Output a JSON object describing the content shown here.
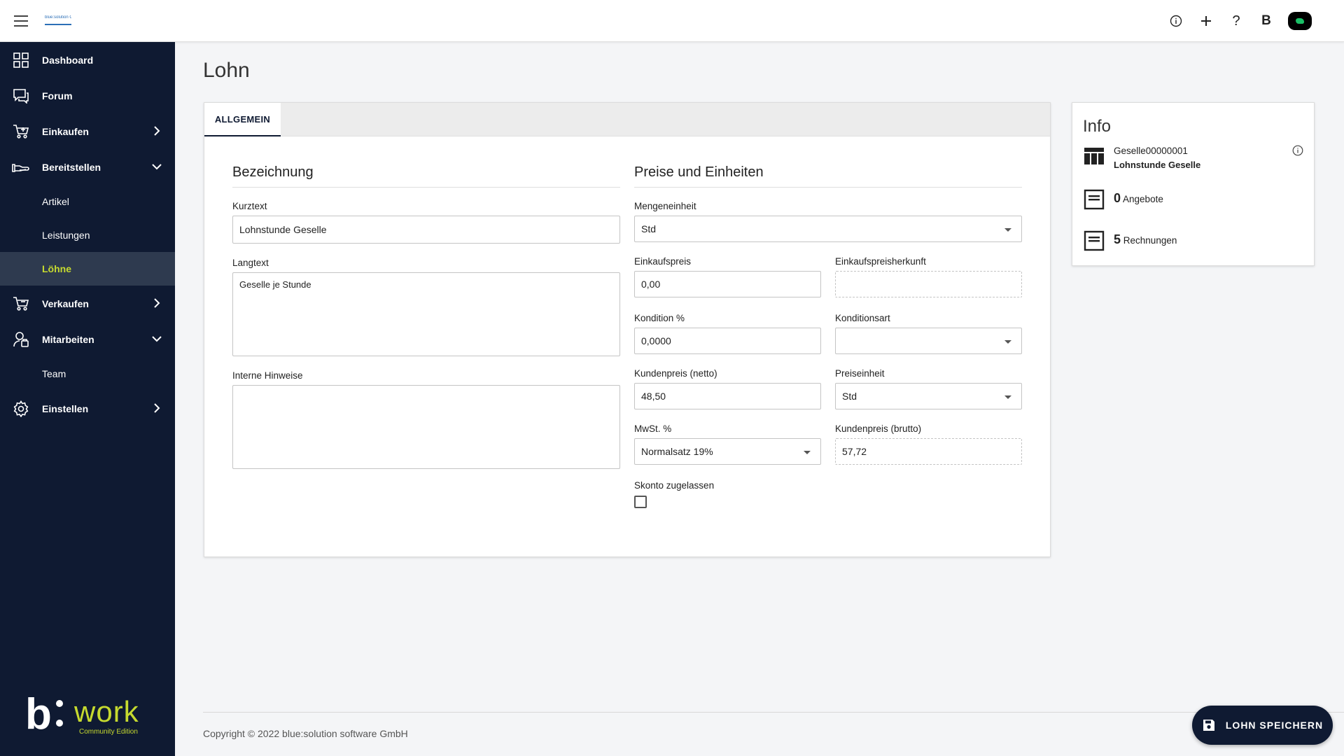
{
  "topbar": {
    "logo_text": "blue:solution GmbH",
    "icons": [
      "info-icon",
      "plus-icon",
      "help-icon",
      "b-icon",
      "avatar"
    ],
    "help_glyph": "?",
    "plus_glyph": "+",
    "info_glyph": "ⓘ",
    "b_glyph": "B"
  },
  "sidebar": {
    "items": [
      {
        "label": "Dashboard",
        "icon": "dashboard-icon"
      },
      {
        "label": "Forum",
        "icon": "forum-icon"
      },
      {
        "label": "Einkaufen",
        "icon": "cart-icon",
        "chevron": "right"
      },
      {
        "label": "Bereitstellen",
        "icon": "provide-icon",
        "chevron": "down"
      },
      {
        "label": "Verkaufen",
        "icon": "sell-icon",
        "chevron": "right"
      },
      {
        "label": "Mitarbeiten",
        "icon": "employees-icon",
        "chevron": "down"
      },
      {
        "label": "Einstellen",
        "icon": "settings-icon",
        "chevron": "right"
      }
    ],
    "sub_bereitstellen": [
      "Artikel",
      "Leistungen",
      "Löhne"
    ],
    "sub_mitarbeiten": [
      "Team"
    ],
    "active_sub": "Löhne",
    "brand": {
      "b": "b",
      "work": "work",
      "edition": "Community Edition"
    },
    "colors": {
      "background": "#0f1a32",
      "active_bg": "#2e3a4f",
      "accent": "#c6da2f"
    }
  },
  "page": {
    "title": "Lohn",
    "tab_label": "ALLGEMEIN"
  },
  "form": {
    "section_left": "Bezeichnung",
    "section_right": "Preise und Einheiten",
    "kurztext_label": "Kurztext",
    "kurztext_value": "Lohnstunde Geselle",
    "langtext_label": "Langtext",
    "langtext_value": "Geselle je Stunde",
    "hinweise_label": "Interne Hinweise",
    "hinweise_value": "",
    "mengeneinheit_label": "Mengeneinheit",
    "mengeneinheit_value": "Std",
    "einkaufspreis_label": "Einkaufspreis",
    "einkaufspreis_value": "0,00",
    "einkaufspreisherkunft_label": "Einkaufspreisherkunft",
    "einkaufspreisherkunft_value": "",
    "kondition_label": "Kondition %",
    "kondition_value": "0,0000",
    "konditionsart_label": "Konditionsart",
    "konditionsart_value": "",
    "kundenpreis_netto_label": "Kundenpreis (netto)",
    "kundenpreis_netto_value": "48,50",
    "preiseinheit_label": "Preiseinheit",
    "preiseinheit_value": "Std",
    "mwst_label": "MwSt. %",
    "mwst_value": "Normalsatz 19%",
    "kundenpreis_brutto_label": "Kundenpreis (brutto)",
    "kundenpreis_brutto_value": "57,72",
    "skonto_label": "Skonto zugelassen",
    "skonto_checked": false
  },
  "info": {
    "title": "Info",
    "code": "Geselle00000001",
    "description": "Lohnstunde Geselle",
    "angebote_count": "0",
    "angebote_label": "Angebote",
    "rechnungen_count": "5",
    "rechnungen_label": "Rechnungen"
  },
  "footer": {
    "copyright": "Copyright © 2022 blue:solution software GmbH",
    "save_label": "LOHN SPEICHERN"
  }
}
